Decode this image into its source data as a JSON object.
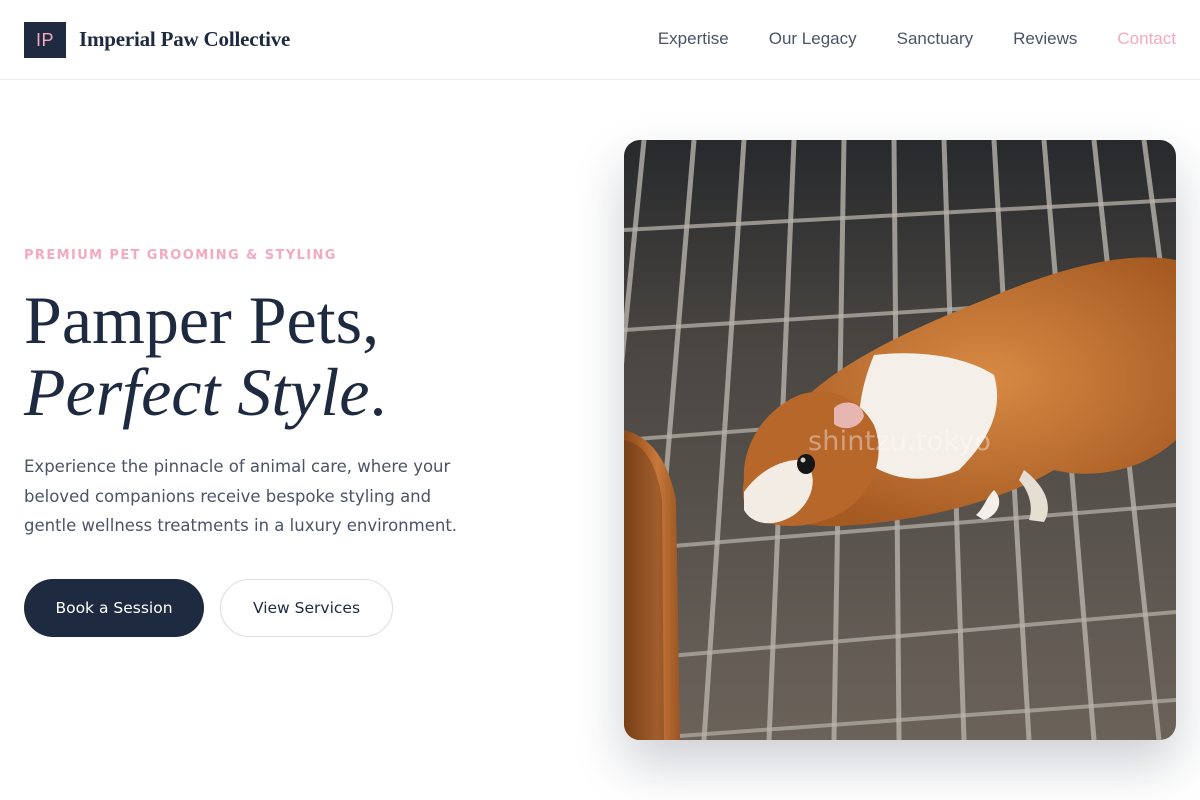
{
  "brand": {
    "mark": "IP",
    "name": "Imperial Paw Collective"
  },
  "nav": {
    "items": [
      {
        "label": "Expertise"
      },
      {
        "label": "Our Legacy"
      },
      {
        "label": "Sanctuary"
      },
      {
        "label": "Reviews"
      },
      {
        "label": "Contact"
      }
    ]
  },
  "hero": {
    "eyebrow": "PREMIUM PET GROOMING & STYLING",
    "headline_line1": "Pamper Pets,",
    "headline_line2": "Perfect Style",
    "headline_period": ".",
    "lead": "Experience the pinnacle of animal care, where your beloved companions receive bespoke styling and gentle wellness treatments in a luxury environment.",
    "primary_cta": "Book a Session",
    "secondary_cta": "View Services",
    "image_watermark": "shintzu.tokyo"
  },
  "colors": {
    "navy": "#1e2a40",
    "accent_pink": "#f4a9bf",
    "body_text": "#4a5468"
  }
}
